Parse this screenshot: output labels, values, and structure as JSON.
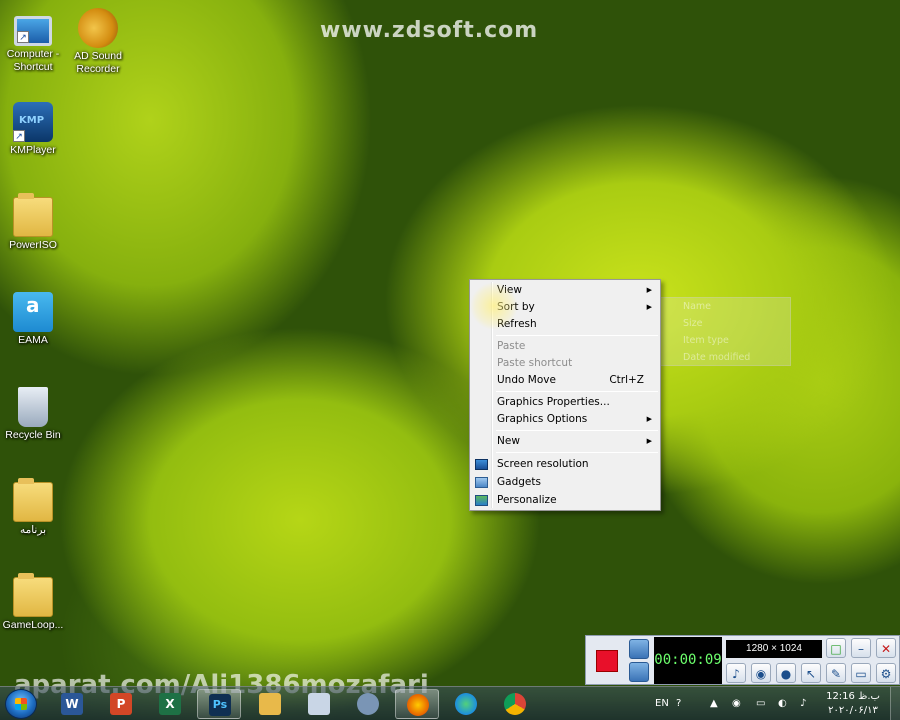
{
  "watermarks": {
    "top": "www.zdsoft.com",
    "bottom": "aparat.com/Ali1386mozafari"
  },
  "desktop_icons": [
    {
      "label": "Computer - Shortcut",
      "icon": "computer-icon"
    },
    {
      "label": "AD Sound Recorder",
      "icon": "speaker-icon"
    },
    {
      "label": "KMPlayer",
      "icon": "kmplayer-icon"
    },
    {
      "label": "PowerISO",
      "icon": "folder-icon"
    },
    {
      "label": "EAMA",
      "icon": "eama-icon"
    },
    {
      "label": "Recycle Bin",
      "icon": "recycle-bin-icon"
    },
    {
      "label": "برنامه",
      "icon": "folder-icon"
    },
    {
      "label": "GameLoop...",
      "icon": "folder-icon"
    }
  ],
  "context_menu": {
    "items": [
      {
        "label": "View",
        "submenu": true
      },
      {
        "label": "Sort by",
        "submenu": true
      },
      {
        "label": "Refresh"
      },
      {
        "label": "Paste",
        "disabled": true
      },
      {
        "label": "Paste shortcut",
        "disabled": true
      },
      {
        "label": "Undo Move",
        "shortcut": "Ctrl+Z"
      },
      {
        "label": "Graphics Properties..."
      },
      {
        "label": "Graphics Options",
        "submenu": true
      },
      {
        "label": "New",
        "submenu": true
      },
      {
        "label": "Screen resolution",
        "icon": "screen-resolution-icon"
      },
      {
        "label": "Gadgets",
        "icon": "gadgets-icon"
      },
      {
        "label": "Personalize",
        "icon": "personalize-icon"
      }
    ],
    "arrow_glyph": "▶"
  },
  "sort_submenu": {
    "items": [
      "Name",
      "Size",
      "Item type",
      "Date modified"
    ]
  },
  "recorder": {
    "timer": "00:00:09",
    "resolution": "1280 × 1024"
  },
  "taskbar": {
    "apps": [
      {
        "name": "word",
        "glyph": "W",
        "color": "#2b5797"
      },
      {
        "name": "powerpoint",
        "glyph": "P",
        "color": "#d24726"
      },
      {
        "name": "excel",
        "glyph": "X",
        "color": "#1e7145"
      },
      {
        "name": "photoshop",
        "glyph": "Ps",
        "color": "#0f2f52"
      },
      {
        "name": "file-explorer",
        "glyph": "",
        "color": "#e8b94a"
      },
      {
        "name": "calculator",
        "glyph": "",
        "color": "#c9d6e6"
      },
      {
        "name": "tools",
        "glyph": "",
        "color": "#7a95b5"
      },
      {
        "name": "firefox",
        "glyph": "",
        "color": "#e66000"
      },
      {
        "name": "edge",
        "glyph": "",
        "color": "#1c8ee0"
      },
      {
        "name": "chrome",
        "glyph": "",
        "color": "#db4437"
      }
    ],
    "language": "EN",
    "clock_time": "12:16 ب.ظ",
    "clock_date": "۲۰۲۰/۰۶/۱۳"
  }
}
